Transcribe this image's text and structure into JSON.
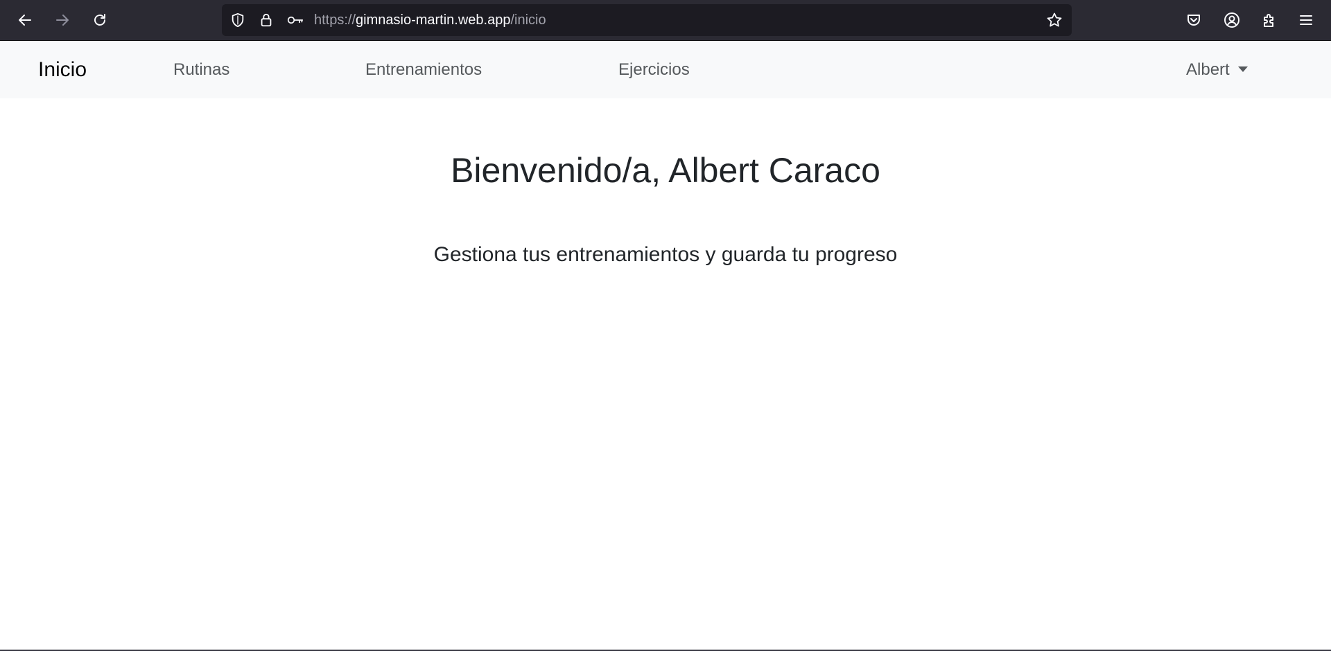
{
  "browser": {
    "url_scheme": "https://",
    "url_host": "gimnasio-martin.web.app",
    "url_path": "/inicio",
    "icons": {
      "back": "arrow-left-icon",
      "forward": "arrow-right-icon",
      "reload": "reload-icon",
      "shield": "shield-icon",
      "lock": "lock-icon",
      "key": "key-icon",
      "bookmark": "star-icon",
      "pocket": "pocket-icon",
      "account": "account-icon",
      "extensions": "puzzle-icon",
      "menu": "hamburger-menu-icon"
    },
    "colors": {
      "toolbar_bg": "#2b2a33",
      "url_bar_bg": "#1c1b22"
    }
  },
  "navbar": {
    "brand": "Inicio",
    "links": [
      {
        "label": "Rutinas"
      },
      {
        "label": "Entrenamientos"
      },
      {
        "label": "Ejercicios"
      }
    ],
    "user_menu_label": "Albert",
    "colors": {
      "bg": "#f8f9fa",
      "link": "#55595c",
      "brand": "#000000"
    }
  },
  "main": {
    "title": "Bienvenido/a, Albert Caraco",
    "subtitle": "Gestiona tus entrenamientos y guarda tu progreso"
  }
}
